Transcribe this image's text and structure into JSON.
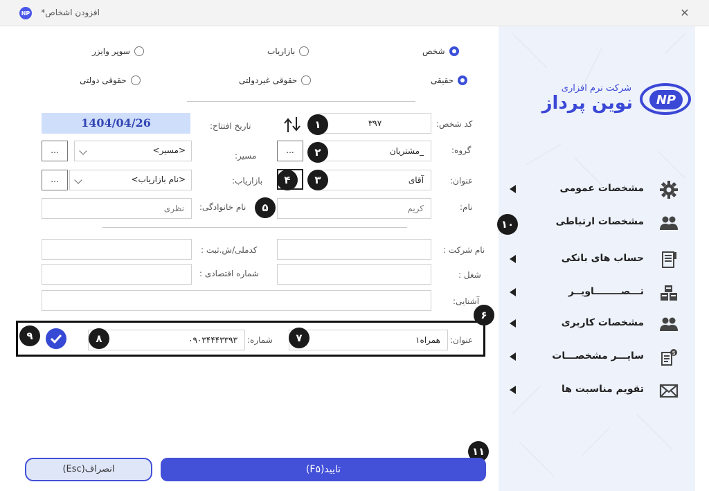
{
  "window": {
    "title": "افزودن اشخاص*",
    "app_icon_text": "NP",
    "close_glyph": "✕"
  },
  "entity_type": {
    "options": [
      {
        "label": "شخص",
        "selected": true
      },
      {
        "label": "بازاریاب",
        "selected": false
      },
      {
        "label": "سوپر وایزر",
        "selected": false
      }
    ]
  },
  "legal_type": {
    "options": [
      {
        "label": "حقیقی",
        "selected": true
      },
      {
        "label": "حقوقی غیردولتی",
        "selected": false
      },
      {
        "label": "حقوقی دولتی",
        "selected": false
      }
    ]
  },
  "form": {
    "person_code_label": "کد شخص:",
    "person_code_value": "۳۹۷",
    "opening_date_label": "تاریخ افتتاح:",
    "opening_date_value": "1404/04/26",
    "group_label": "گروه:",
    "group_value": "_مشتریان",
    "route_label": "مسیر:",
    "route_value": "<مسیر>",
    "title_label": "عنوان:",
    "title_value": "آقای",
    "marketer_label": "بازاریاب:",
    "marketer_value": "<نام بازاریاب>",
    "name_label": "نام:",
    "name_value": "کریم",
    "family_label": "نام خانوادگی:",
    "family_value": "نظری",
    "company_label": "نام شرکت :",
    "national_id_label": "کدملی/ش.ثبت :",
    "job_label": "شغل :",
    "economic_code_label": "شماره اقتصادی :",
    "acquaintance_label": "آشنایی:",
    "dots_label": "..."
  },
  "contact": {
    "title_label": "عنوان:",
    "title_value": "همراه۱",
    "number_label": "شماره:",
    "number_value": "۰۹۰۳۴۴۴۳۳۹۳"
  },
  "badges": [
    "۱",
    "۲",
    "۳",
    "۴",
    "۵",
    "۶",
    "۷",
    "۸",
    "۹",
    "۱۰",
    "۱۱"
  ],
  "buttons": {
    "confirm": "تایید(F۵)",
    "cancel": "انصراف(Esc)"
  },
  "brand": {
    "company_line": "شرکت نرم افزاری",
    "name_line": "نوین پرداز",
    "mark": "NP",
    "color": "#3b48d6"
  },
  "sidebar": {
    "items": [
      {
        "label": "مشخصات عمومی",
        "icon": "gear-icon"
      },
      {
        "label": "مشخصات ارتباطی",
        "icon": "users-icon"
      },
      {
        "label": "حساب های بانکی",
        "icon": "ledger-icon"
      },
      {
        "label": "تـــصــــــــاویــر",
        "icon": "images-icon"
      },
      {
        "label": "مشخصات کاربری",
        "icon": "user-group-icon"
      },
      {
        "label": "سایـــر مشخصـــات",
        "icon": "document-dollar-icon"
      },
      {
        "label": "تقویم مناسبت ها",
        "icon": "envelope-icon"
      }
    ]
  },
  "colors": {
    "accent": "#4350d8",
    "sidebar_bg": "#eef2fb",
    "date_bg": "#cfdefa"
  }
}
